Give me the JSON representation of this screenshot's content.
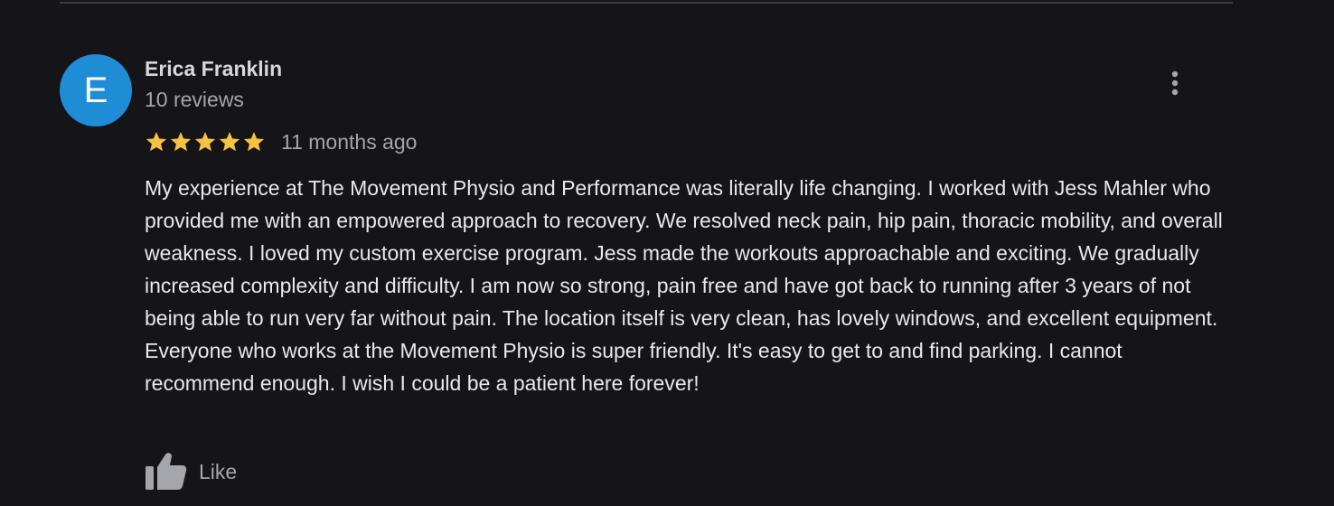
{
  "review": {
    "avatar_letter": "E",
    "reviewer_name": "Erica Franklin",
    "reviewer_meta": "10 reviews",
    "rating": 5,
    "rating_max": 5,
    "time_ago": "11 months ago",
    "text": "My experience at The Movement Physio and Performance was literally life changing. I worked with Jess Mahler who provided me with an empowered approach to recovery. We resolved neck pain, hip pain, thoracic mobility, and overall weakness. I loved my custom exercise program. Jess made the workouts approachable and exciting. We gradually increased complexity and difficulty. I am now so strong, pain free and have got back to running after 3 years of not being able to run very far without pain. The location itself is very clean, has lovely windows, and excellent equipment. Everyone who works at the Movement Physio is super friendly. It's easy to get to and find parking. I cannot recommend enough. I wish I could be a patient here forever!",
    "like_label": "Like",
    "more_icon": "more-vertical-icon",
    "star_icon": "star-icon",
    "like_icon": "thumbs-up-icon"
  },
  "colors": {
    "background": "#141419",
    "avatar": "#1f8dd6",
    "star": "#f5c242",
    "name": "#d7d8dc",
    "meta": "#a4a6ab",
    "text": "#e8e9ec",
    "divider": "#3c3d42"
  }
}
